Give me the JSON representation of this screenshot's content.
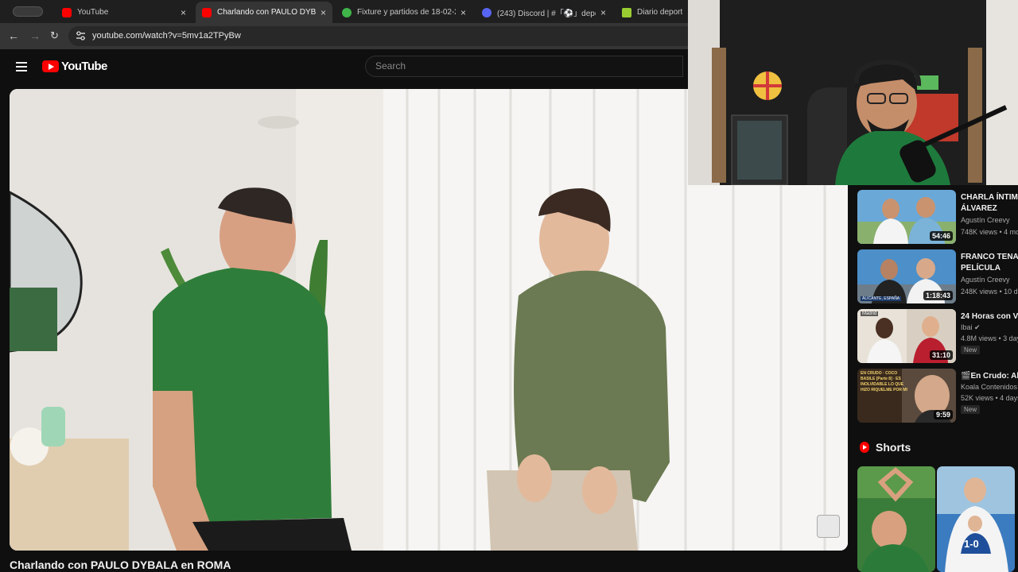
{
  "browser": {
    "tabs": [
      {
        "title": "YouTube",
        "favicon_color": "#ff0000",
        "close": "×"
      },
      {
        "title": "Charlando con PAULO DYBALA",
        "favicon_color": "#ff0000",
        "close": "×"
      },
      {
        "title": "Fixture y partidos de 18-02-2",
        "favicon_color": "#3fb54a",
        "close": "×"
      },
      {
        "title": "(243) Discord | #「⚽」depo",
        "favicon_color": "#5865f2",
        "close": "×"
      },
      {
        "title": "Diario deportivo",
        "favicon_color": "#9acd32",
        "close": ""
      }
    ],
    "url": "youtube.com/watch?v=5mv1a2TPyBw"
  },
  "youtube": {
    "logo_text": "YouTube",
    "search_placeholder": "Search",
    "video_title": "Charlando con PAULO DYBALA en ROMA"
  },
  "sidebar": {
    "recommendations": [
      {
        "title_line1": "CHARLA ÍNTIM",
        "title_line2": "ÁLVAREZ",
        "channel": "Agustín Creevy",
        "meta": "748K views • 4 mo",
        "duration": "54:46",
        "is_new": false
      },
      {
        "title_line1": "FRANCO TENAC",
        "title_line2": "PELÍCULA",
        "channel": "Agustín Creevy",
        "meta": "248K views • 10 d",
        "duration": "1:18:43",
        "is_new": false,
        "thumb_text": "ALICANTE, ESPAÑA"
      },
      {
        "title_line1": "24 Horas con V",
        "title_line2": "",
        "channel": "Ibai ✔",
        "meta": "4.8M views • 3 day",
        "duration": "31:10",
        "is_new": true,
        "new_label": "New",
        "thumb_text": "Madrid"
      },
      {
        "title_line1": "🎬En Crudo: Alf",
        "title_line2": "",
        "channel": "Koala Contenidos",
        "meta": "52K views • 4 days",
        "duration": "9:59",
        "is_new": true,
        "new_label": "New",
        "thumb_text": "EN CRUDO · COCO BASILE [Parte 8] · ES INOLVIDABLE LO QUE HIZO RIQUELME POR MI"
      }
    ],
    "shorts_label": "Shorts",
    "shorts": [
      {
        "overlay": ""
      },
      {
        "overlay": "1-0"
      }
    ]
  },
  "colors": {
    "yt_red": "#ff0000",
    "background": "#0f0f0f",
    "shirt_green": "#2f7d3a"
  }
}
